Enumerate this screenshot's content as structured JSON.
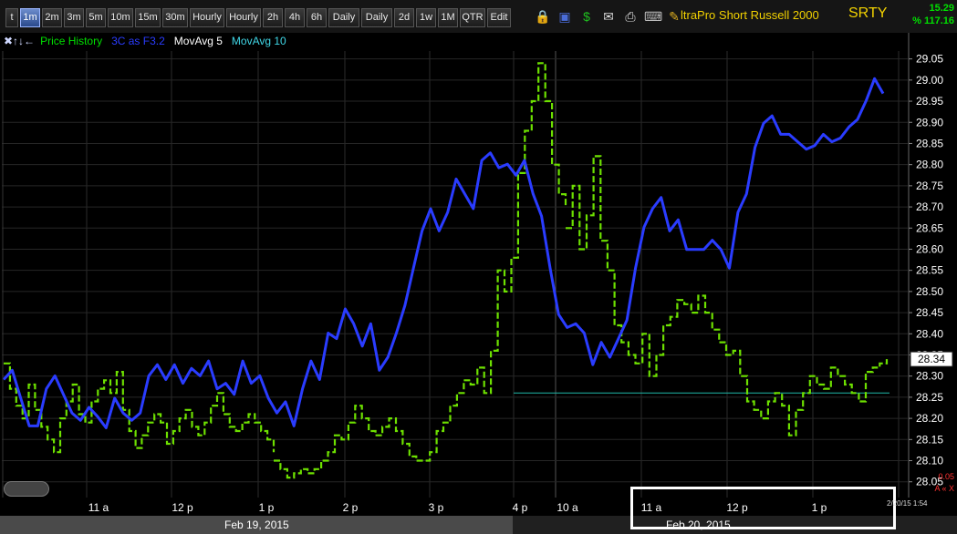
{
  "toolbar": {
    "buttons": [
      "t",
      "1m",
      "2m",
      "3m",
      "5m",
      "10m",
      "15m",
      "30m",
      "Hourly",
      "Hourly",
      "2h",
      "4h",
      "6h",
      "Daily",
      "Daily",
      "2d",
      "1w",
      "1M",
      "QTR",
      "Edit"
    ],
    "active": "1m",
    "icons": [
      "lock-icon",
      "save-icon",
      "dollar-icon",
      "mail-icon",
      "print-icon",
      "keyboard-icon",
      "pencil-icon"
    ],
    "symbol_title": "ltraPro Short Russell 2000",
    "symbol": "SRTY",
    "price": "15.29",
    "pct": "% 117.16"
  },
  "legend": {
    "items": [
      {
        "label": "Price History",
        "color": "#00e000"
      },
      {
        "label": "3C as F3.2",
        "color": "#2a3cff"
      },
      {
        "label": "MovAvg 5",
        "color": "#ffffff"
      },
      {
        "label": "MovAvg 10",
        "color": "#40d8e8"
      }
    ]
  },
  "bottom": {
    "day1": "Feb 19, 2015",
    "day2": "Feb 20, 2015",
    "lr_value": "0.05",
    "lr_controls": "A « X",
    "datestamp": "2/20/15 1:54"
  },
  "chart_data": {
    "type": "line",
    "price_axis": {
      "min": 28.03,
      "max": 29.06,
      "ticks": [
        28.05,
        28.1,
        28.15,
        28.2,
        28.25,
        28.3,
        28.35,
        28.4,
        28.45,
        28.5,
        28.55,
        28.6,
        28.65,
        28.7,
        28.75,
        28.8,
        28.85,
        28.9,
        28.95,
        29.0,
        29.05
      ]
    },
    "current_price": "28.34",
    "time_ticks": [
      "11 a",
      "12 p",
      "1 p",
      "2 p",
      "3 p",
      "4 p",
      "10 a",
      "11 a",
      "12 p",
      "1 p"
    ],
    "price_series": [
      [
        28.33,
        28.27,
        28.23,
        28.2,
        28.28,
        28.22,
        28.18,
        28.15,
        28.12,
        28.2,
        28.24,
        28.28,
        28.21,
        28.19,
        28.24,
        28.27,
        28.29,
        28.26,
        28.31,
        28.22,
        28.17,
        28.13,
        28.16,
        28.19,
        28.21,
        28.19,
        28.14,
        28.17,
        28.2,
        28.22,
        28.18,
        28.16,
        28.19,
        28.23,
        28.26,
        28.21,
        28.18,
        28.17,
        28.19,
        28.21,
        28.19,
        28.17,
        28.15,
        28.12
      ],
      [
        28.1,
        28.08,
        28.06,
        28.07,
        28.08,
        28.07,
        28.08,
        28.1,
        28.12,
        28.16,
        28.15,
        28.19,
        28.23,
        28.2,
        28.17,
        28.16,
        28.18,
        28.2,
        28.17,
        28.14,
        28.11,
        28.1,
        28.1,
        28.12,
        28.17,
        28.19,
        28.23,
        28.26,
        28.29,
        28.28,
        28.32,
        28.26,
        28.36,
        28.55,
        28.5,
        28.58,
        28.78,
        28.88,
        28.95,
        29.04,
        28.95,
        28.8,
        28.73,
        28.7
      ],
      [
        28.65,
        28.75,
        28.6,
        28.68,
        28.82,
        28.62,
        28.55,
        28.42,
        28.38,
        28.35,
        28.33,
        28.4,
        28.3,
        28.35,
        28.42,
        28.44,
        28.48,
        28.47,
        28.45,
        28.49,
        28.45,
        28.41,
        28.38,
        28.35,
        28.36,
        28.3,
        28.24,
        28.22,
        28.2,
        28.24,
        28.26,
        28.23,
        28.16,
        28.22,
        28.26,
        28.3,
        28.28,
        28.27,
        28.32,
        28.3,
        28.28,
        28.26,
        28.24,
        28.31,
        28.32,
        28.33,
        28.34
      ]
    ],
    "indicator_3c": [
      0.3,
      0.35,
      0.2,
      0.05,
      0.05,
      0.25,
      0.32,
      0.22,
      0.12,
      0.08,
      0.15,
      0.1,
      0.04,
      0.2,
      0.12,
      0.08,
      0.12,
      0.32,
      0.38,
      0.3,
      0.38,
      0.28,
      0.36,
      0.32,
      0.4,
      0.25,
      0.28,
      0.22,
      0.4,
      0.28,
      0.32,
      0.2,
      0.12,
      0.18,
      0.05,
      0.25,
      0.4,
      0.3,
      0.55,
      0.52,
      0.68,
      0.6,
      0.48,
      0.6,
      0.35,
      0.42,
      0.55,
      0.7,
      0.9,
      1.1,
      1.22,
      1.1,
      1.2,
      1.38,
      1.3,
      1.22,
      1.48,
      1.52,
      1.44,
      1.46,
      1.4,
      1.48,
      1.3,
      1.18,
      0.9,
      0.65,
      0.58,
      0.6,
      0.55,
      0.38,
      0.5,
      0.42,
      0.52,
      0.62,
      0.9,
      1.12,
      1.22,
      1.28,
      1.1,
      1.16,
      1.0,
      1.0,
      1.0,
      1.05,
      1.0,
      0.9,
      1.2,
      1.3,
      1.55,
      1.68,
      1.72,
      1.62,
      1.62,
      1.58,
      1.54,
      1.56,
      1.62,
      1.58,
      1.6,
      1.66,
      1.7,
      1.8,
      1.92,
      1.84
    ],
    "reference_price": 28.26
  }
}
